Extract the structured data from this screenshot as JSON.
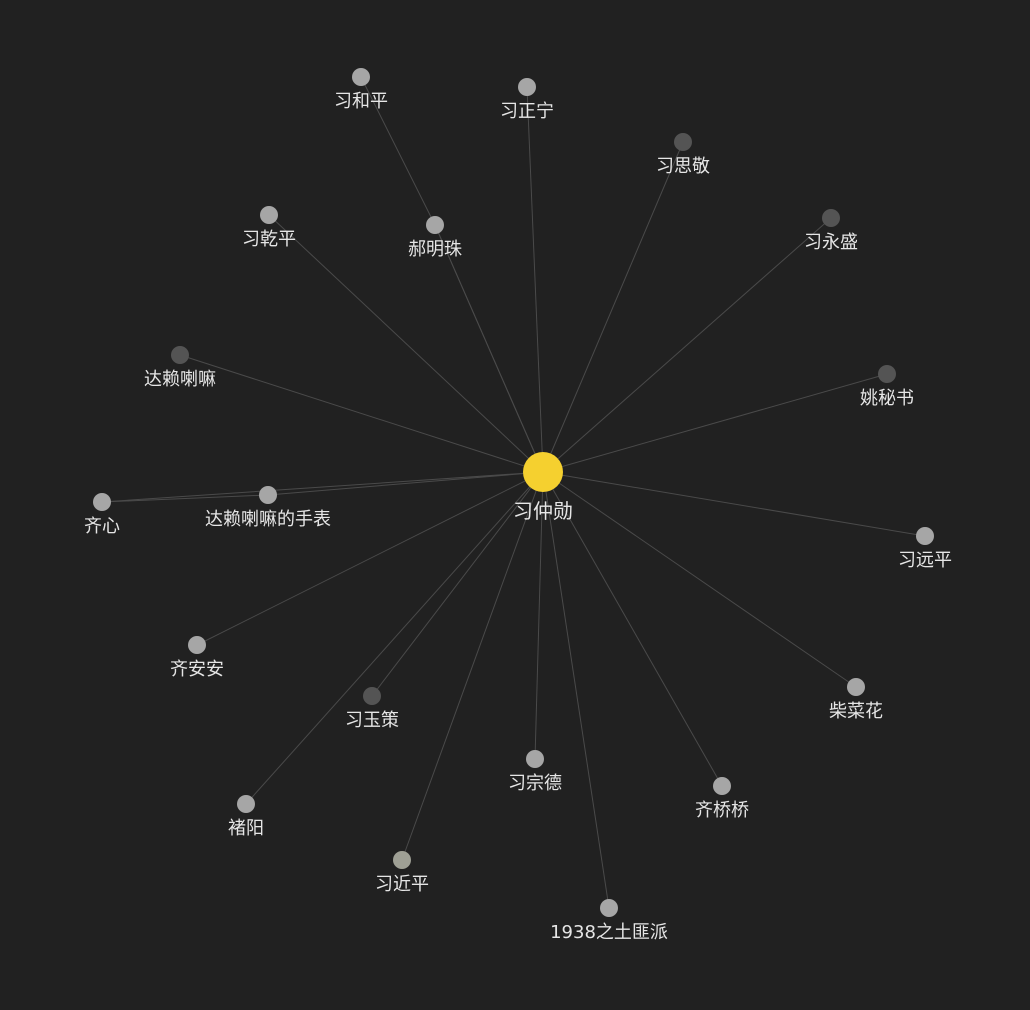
{
  "graph": {
    "background_color": "#212121",
    "edge_color": "#4a4a4a",
    "center": {
      "id": "xi-zhongxun",
      "label": "习仲勋",
      "color": "#f5d02f"
    },
    "nodes": [
      {
        "id": "xi-heping",
        "label": "习和平",
        "color": "#a6a6a6"
      },
      {
        "id": "xi-zhengning",
        "label": "习正宁",
        "color": "#a6a6a6"
      },
      {
        "id": "xi-sijing",
        "label": "习思敬",
        "color": "#545454"
      },
      {
        "id": "xi-qianping",
        "label": "习乾平",
        "color": "#a6a6a6"
      },
      {
        "id": "hao-mingzhu",
        "label": "郝明珠",
        "color": "#a6a6a6"
      },
      {
        "id": "xi-yongsheng",
        "label": "习永盛",
        "color": "#545454"
      },
      {
        "id": "dalai-lama",
        "label": "达赖喇嘛",
        "color": "#545454"
      },
      {
        "id": "yao-mishu",
        "label": "姚秘书",
        "color": "#545454"
      },
      {
        "id": "qi-xin",
        "label": "齐心",
        "color": "#a6a6a6"
      },
      {
        "id": "dalai-lama-watch",
        "label": "达赖喇嘛的手表",
        "color": "#a6a6a6"
      },
      {
        "id": "xi-yuanping",
        "label": "习远平",
        "color": "#a6a6a6"
      },
      {
        "id": "qi-anan",
        "label": "齐安安",
        "color": "#a6a6a6"
      },
      {
        "id": "xi-yuce",
        "label": "习玉策",
        "color": "#545454"
      },
      {
        "id": "chai-caihua",
        "label": "柴菜花",
        "color": "#a6a6a6"
      },
      {
        "id": "xi-zongde",
        "label": "习宗德",
        "color": "#a6a6a6"
      },
      {
        "id": "qi-qiaoqiao",
        "label": "齐桥桥",
        "color": "#a6a6a6"
      },
      {
        "id": "chu-yang",
        "label": "褚阳",
        "color": "#a6a6a6"
      },
      {
        "id": "xi-jinping",
        "label": "习近平",
        "color": "#9fa095"
      },
      {
        "id": "tufei-1938",
        "label": "1938之土匪派",
        "color": "#a6a6a6"
      }
    ]
  }
}
